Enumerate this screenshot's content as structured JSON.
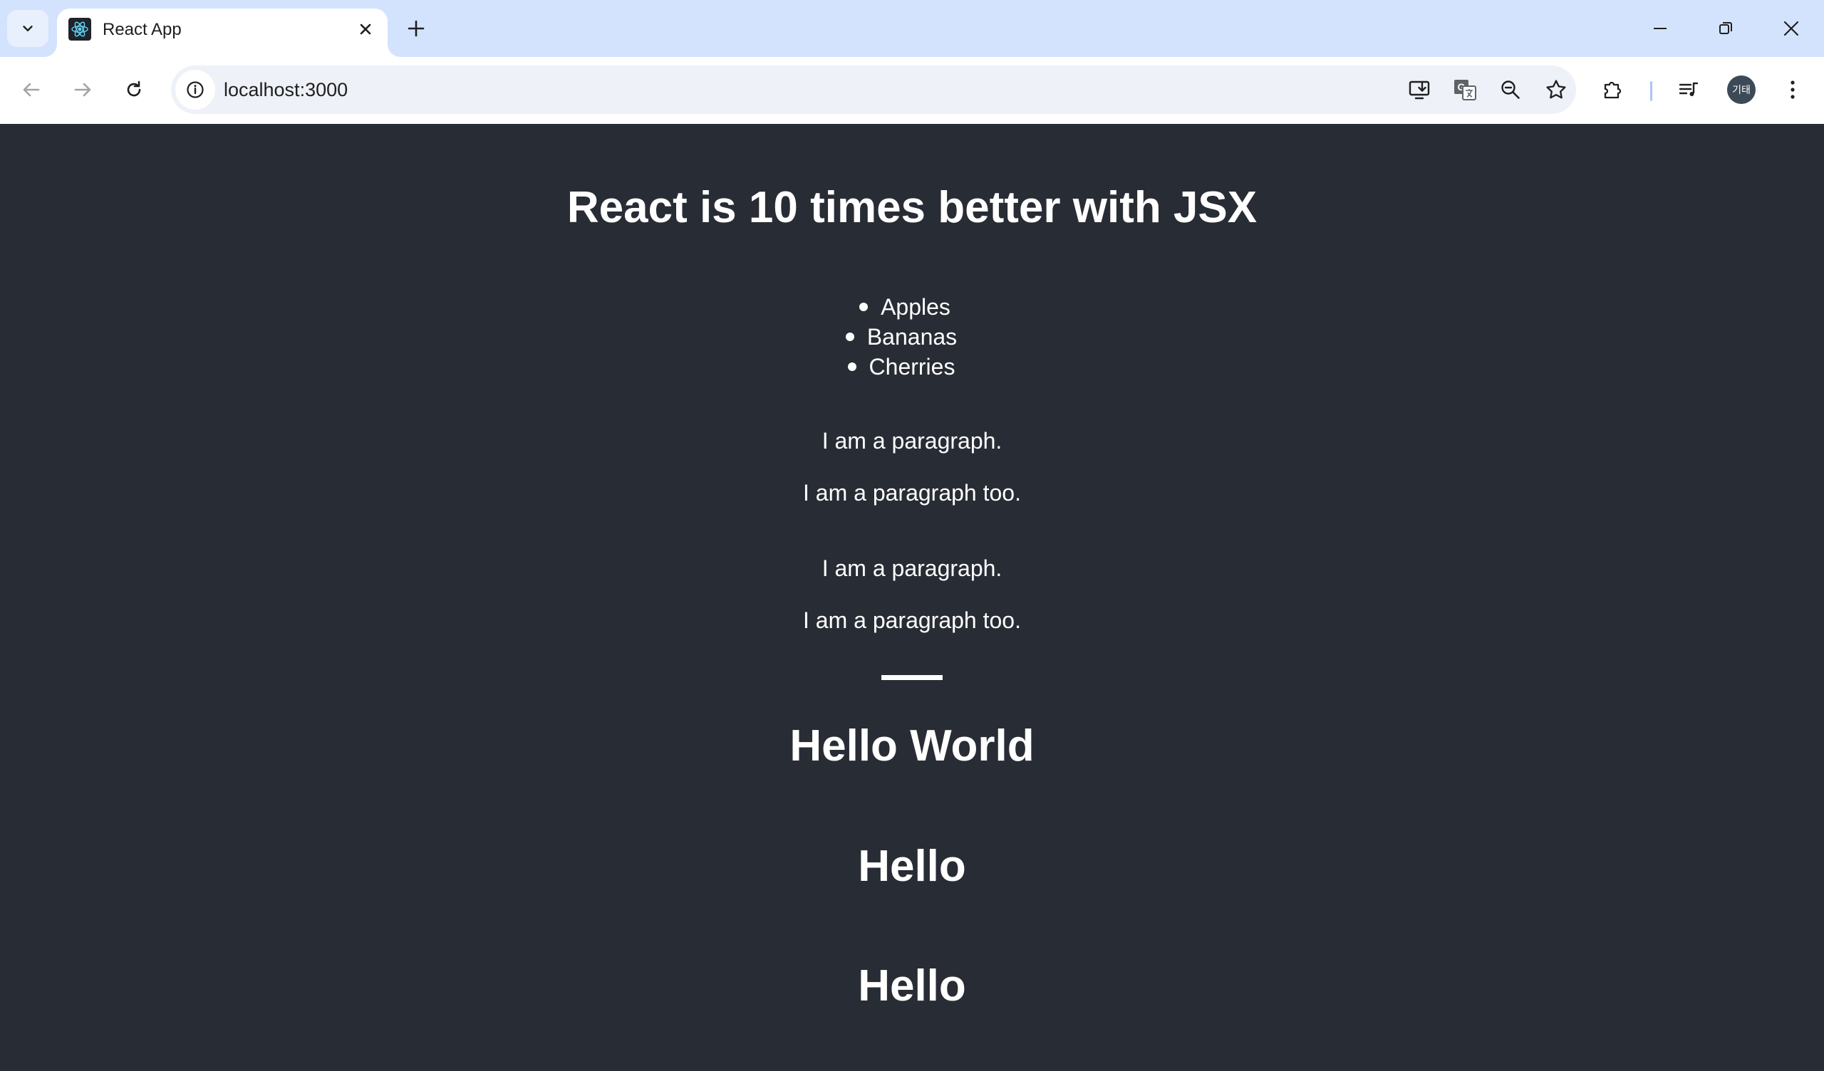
{
  "browser": {
    "tab": {
      "title": "React App",
      "favicon": "react-logo-icon"
    },
    "address_bar": {
      "url": "localhost:3000"
    },
    "profile": {
      "initials": "기태"
    }
  },
  "page": {
    "title": "React is 10 times better with JSX",
    "fruits": [
      "Apples",
      "Bananas",
      "Cherries"
    ],
    "paragraphs_1": [
      "I am a paragraph.",
      "I am a paragraph too."
    ],
    "paragraphs_2": [
      "I am a paragraph.",
      "I am a paragraph too."
    ],
    "hello_world": "Hello World",
    "hello_1": "Hello",
    "hello_2": "Hello"
  },
  "colors": {
    "page_background": "#282c34",
    "text": "#ffffff",
    "tabstrip": "#d3e3fd",
    "omnibox": "#eef1f8"
  }
}
